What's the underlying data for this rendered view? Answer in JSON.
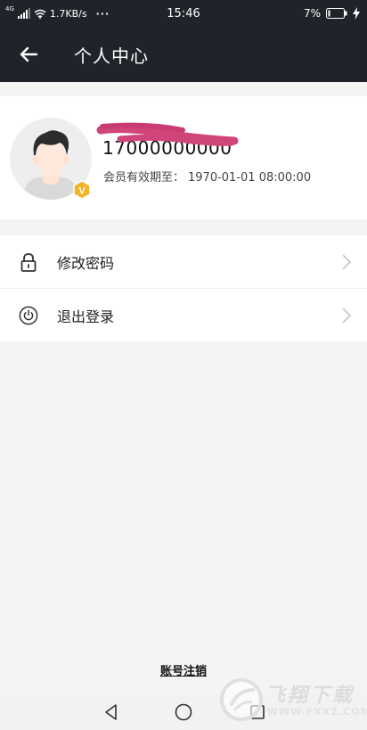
{
  "status_bar": {
    "network": "4G",
    "speed": "1.7KB/s",
    "more": "···",
    "time": "15:46",
    "battery": "7%"
  },
  "header": {
    "title": "个人中心",
    "back_icon": "arrow-left-icon"
  },
  "profile": {
    "phone": "17000000000",
    "expire_label": "会员有效期至：",
    "expire_value": "1970-01-01 08:00:00",
    "vip_badge": "V",
    "redaction_color": "#d0457a"
  },
  "menu": [
    {
      "label": "修改密码",
      "icon": "lock-icon"
    },
    {
      "label": "退出登录",
      "icon": "power-icon"
    }
  ],
  "footer": {
    "cancel_account": "账号注销"
  },
  "watermark": {
    "text": "飞翔下载",
    "url": "WWW.FXXZ.COM"
  },
  "colors": {
    "header_bg": "#20232a",
    "page_bg": "#f4f4f4",
    "vip_gold": "#f0b429"
  }
}
